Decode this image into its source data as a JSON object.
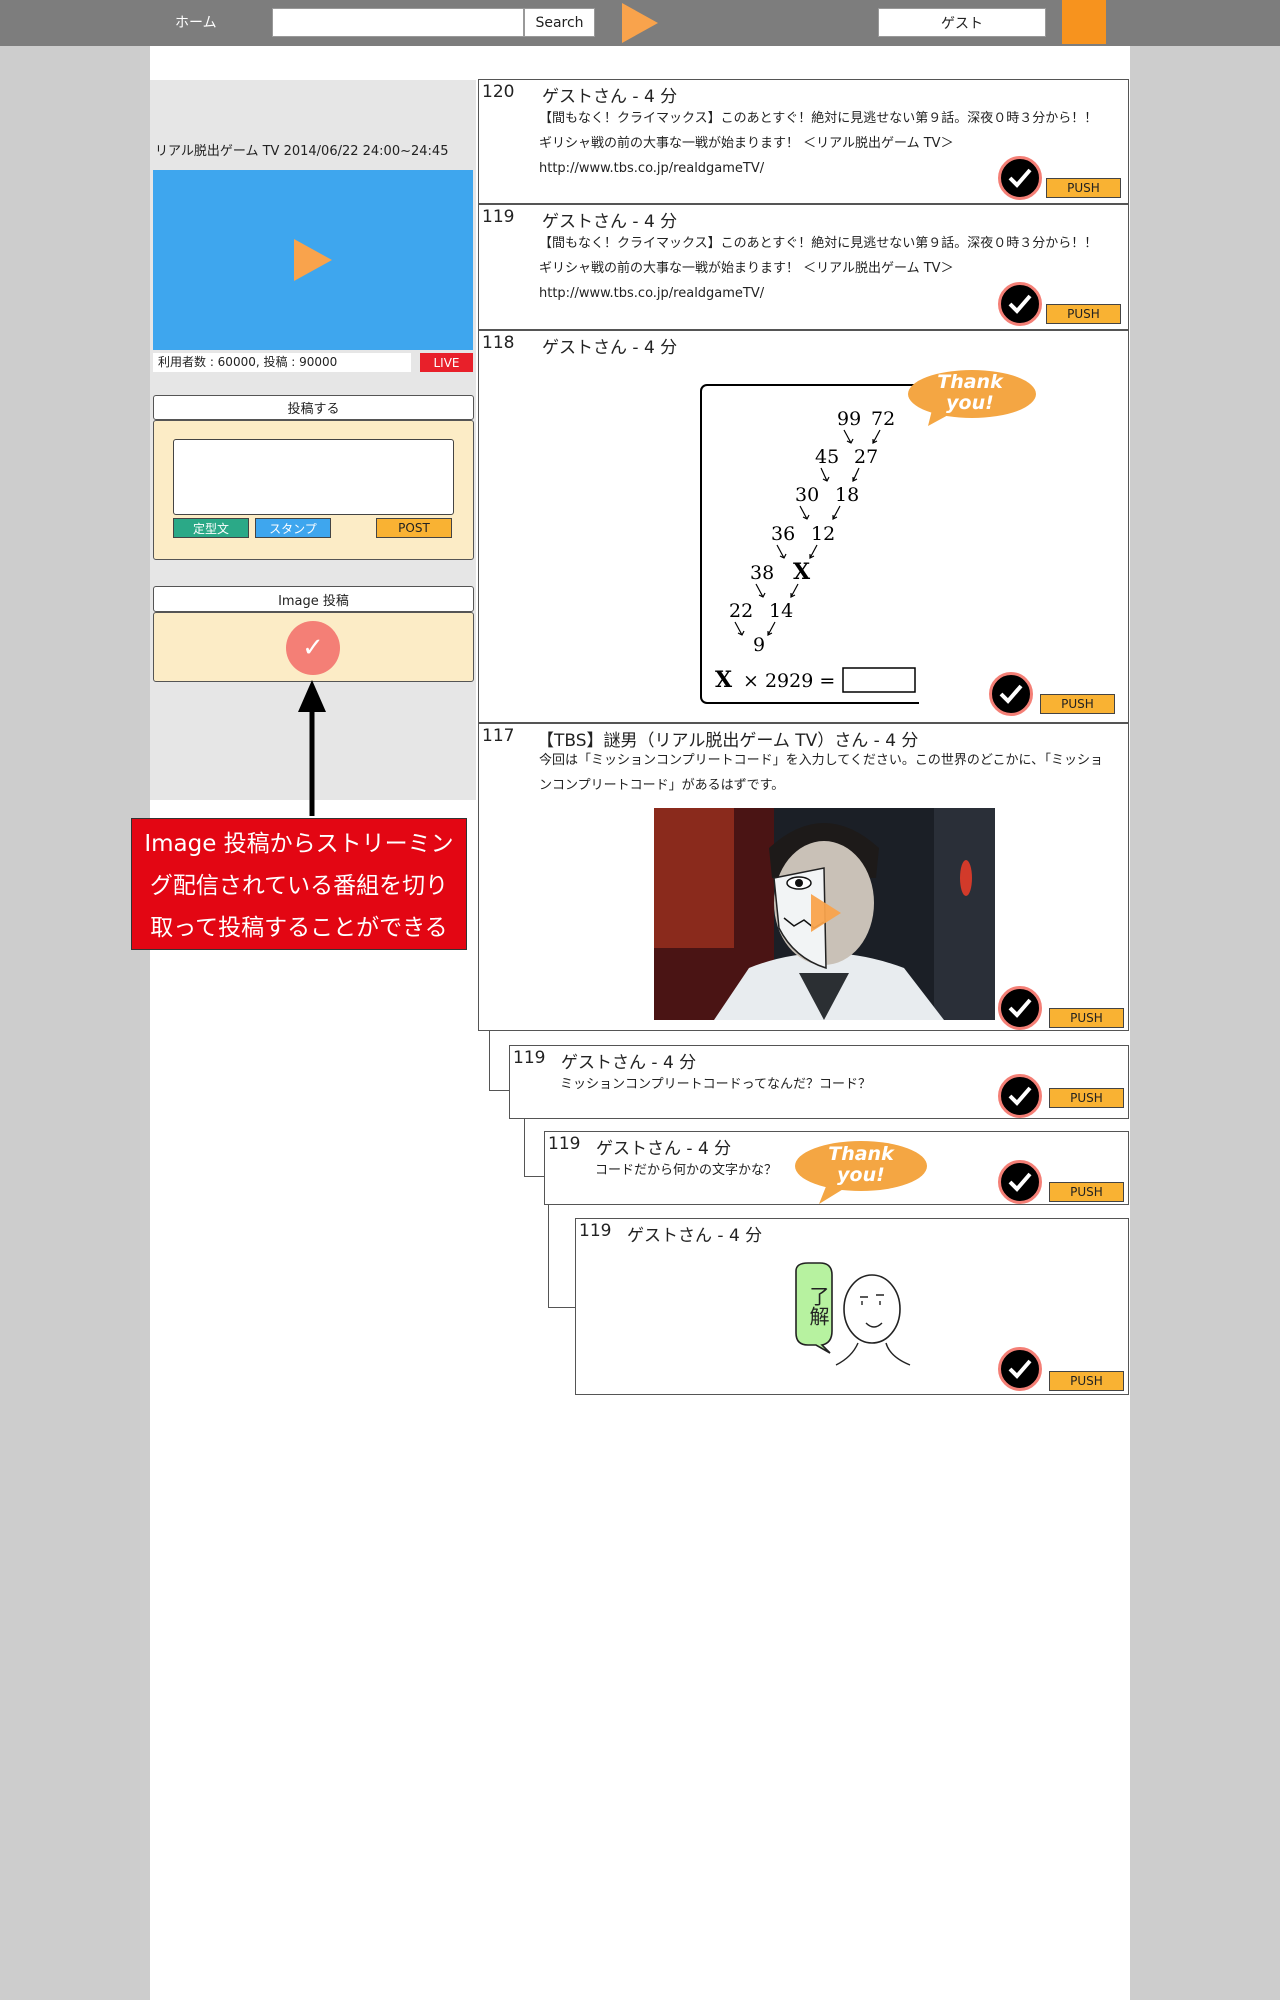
{
  "nav": {
    "home": "ホーム",
    "search_placeholder": "",
    "search_button": "Search",
    "guest": "ゲスト"
  },
  "sidebar": {
    "program_title": "リアル脱出ゲーム TV 2014/06/22 24:00~24:45",
    "stats": "利用者数 : 60000, 投稿 : 90000",
    "live": "LIVE",
    "post_header": "投稿する",
    "teikei_button": "定型文",
    "stamp_button": "スタンプ",
    "post_button": "POST",
    "image_post_header": "Image 投稿",
    "annotation_lines": [
      "Image 投稿からストリーミン",
      "グ配信されている番組を切り",
      "取って投稿することができる"
    ]
  },
  "feed": {
    "push_label": "PUSH",
    "posts": [
      {
        "number": "120",
        "user": "ゲストさん - 4 分",
        "lines": [
          "【間もなく！クライマックス】このあとすぐ！絶対に見逃せない第９話。深夜０時３分から！！",
          "ギリシャ戦の前の大事な一戦が始まります！ ＜リアル脱出ゲーム TV＞",
          "http://www.tbs.co.jp/realdgameTV/"
        ]
      },
      {
        "number": "119",
        "user": "ゲストさん - 4 分",
        "lines": [
          "【間もなく！クライマックス】このあとすぐ！絶対に見逃せない第９話。深夜０時３分から！！",
          "ギリシャ戦の前の大事な一戦が始まります！ ＜リアル脱出ゲーム TV＞",
          "http://www.tbs.co.jp/realdgameTV/"
        ]
      },
      {
        "number": "118",
        "user": "ゲストさん - 4 分",
        "puzzle": {
          "rows": [
            [
              "99",
              "72"
            ],
            [
              "45",
              "27"
            ],
            [
              "30",
              "18"
            ],
            [
              "36",
              "12"
            ],
            [
              "38",
              "X"
            ],
            [
              "22",
              "14"
            ],
            [
              "9"
            ]
          ],
          "equation_var": "X",
          "equation_rest": "× 2929 ="
        },
        "bubble": [
          "Thank",
          "you!"
        ]
      },
      {
        "number": "117",
        "user": "【TBS】謎男（リアル脱出ゲーム TV）さん - 4 分",
        "lines": [
          "今回は「ミッションコンプリートコード」を入力してください。この世界のどこかに､「ミッショ",
          "ンコンプリートコード」があるはずです。"
        ]
      },
      {
        "number": "119",
        "user": "ゲストさん - 4 分",
        "lines": [
          "ミッションコンプリートコードってなんだ？コード？"
        ]
      },
      {
        "number": "119",
        "user": "ゲストさん - 4 分",
        "lines": [
          "コードだから何かの文字かな？"
        ],
        "bubble": [
          "Thank",
          "you!"
        ]
      },
      {
        "number": "119",
        "user": "ゲストさん - 4 分",
        "sticker_text": "了解"
      }
    ]
  },
  "colors": {
    "topbar": "#7d7d7d",
    "accent_orange": "#f7931e",
    "player_blue": "#3ea6ee",
    "live_red": "#e8202a",
    "panel_cream": "#fcecc6",
    "push_yellow": "#f9b233",
    "check_ring": "#f47f76",
    "annotation_red": "#e30613"
  },
  "icons": {
    "nav_play": "play-triangle-icon",
    "player_play": "play-triangle-icon",
    "check": "checkmark-circle-icon",
    "image_post": "checkmark-icon",
    "arrow": "up-arrow-icon"
  }
}
